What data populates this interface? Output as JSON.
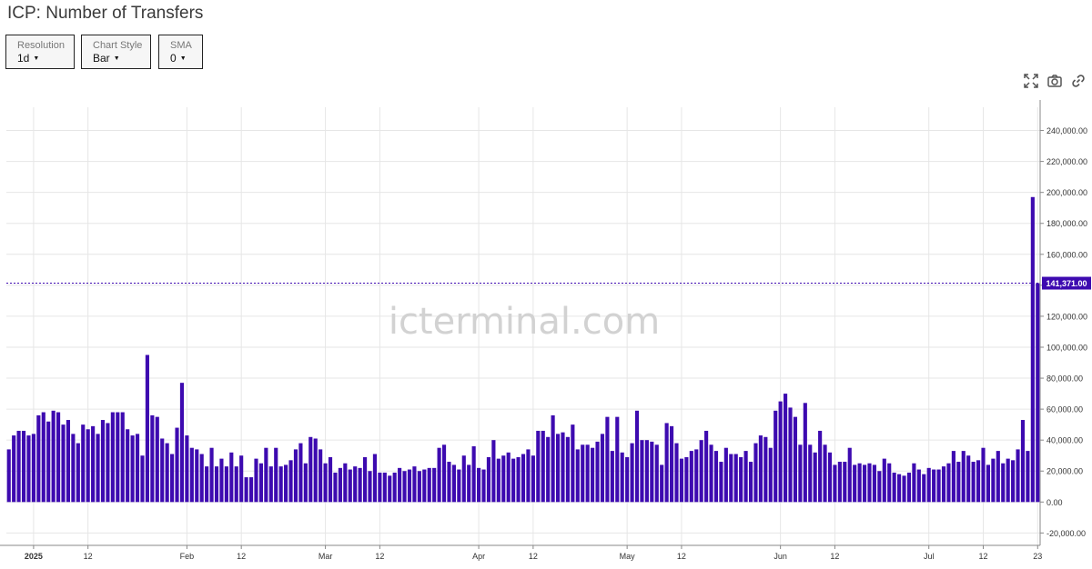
{
  "header": {
    "title": "ICP: Number of Transfers"
  },
  "controls": [
    {
      "label": "Resolution",
      "value": "1d"
    },
    {
      "label": "Chart Style",
      "value": "Bar"
    },
    {
      "label": "SMA",
      "value": "0"
    }
  ],
  "toolbar": {
    "icons": [
      "expand-icon",
      "camera-icon",
      "link-icon"
    ]
  },
  "watermark": "icterminal.com",
  "colors": {
    "bar": "#3d0ab0",
    "price_line": "#3d0ab0",
    "price_tag_bg": "#3d0ab0",
    "grid": "#e6e6e6",
    "text": "#333333"
  },
  "chart_data": {
    "type": "bar",
    "title": "ICP: Number of Transfers",
    "x_start": "2024-12-27",
    "x_tick_labels": [
      {
        "date": "2025-01-01",
        "label": "2025",
        "bold": true
      },
      {
        "date": "2025-01-12",
        "label": "12",
        "bold": false
      },
      {
        "date": "2025-02-01",
        "label": "Feb",
        "bold": false
      },
      {
        "date": "2025-02-12",
        "label": "12",
        "bold": false
      },
      {
        "date": "2025-03-01",
        "label": "Mar",
        "bold": false
      },
      {
        "date": "2025-03-12",
        "label": "12",
        "bold": false
      },
      {
        "date": "2025-04-01",
        "label": "Apr",
        "bold": false
      },
      {
        "date": "2025-04-12",
        "label": "12",
        "bold": false
      },
      {
        "date": "2025-05-01",
        "label": "May",
        "bold": false
      },
      {
        "date": "2025-05-12",
        "label": "12",
        "bold": false
      },
      {
        "date": "2025-06-01",
        "label": "Jun",
        "bold": false
      },
      {
        "date": "2025-06-12",
        "label": "12",
        "bold": false
      },
      {
        "date": "2025-07-01",
        "label": "Jul",
        "bold": false
      },
      {
        "date": "2025-07-12",
        "label": "12",
        "bold": false
      },
      {
        "date": "2025-07-23",
        "label": "23",
        "bold": false
      }
    ],
    "y_tick_labels": [
      "-20,000.00",
      "0.00",
      "20,000.00",
      "40,000.00",
      "60,000.00",
      "80,000.00",
      "100,000.00",
      "120,000.00",
      "140,000.00",
      "160,000.00",
      "180,000.00",
      "200,000.00",
      "220,000.00",
      "240,000.00"
    ],
    "ylim": [
      -28000,
      255000
    ],
    "grid": true,
    "last_value": 141371,
    "last_value_label": "141,371.00",
    "values": [
      34000,
      43000,
      46000,
      46000,
      43000,
      44000,
      56000,
      58000,
      52000,
      59000,
      58000,
      50000,
      53000,
      44000,
      38000,
      50000,
      47000,
      49000,
      44000,
      53000,
      51000,
      58000,
      58000,
      58000,
      47000,
      43000,
      44000,
      30000,
      95000,
      56000,
      55000,
      41000,
      38000,
      31000,
      48000,
      77000,
      43000,
      35000,
      34000,
      31000,
      23000,
      35000,
      23000,
      28000,
      23000,
      32000,
      23000,
      30000,
      16000,
      16000,
      28000,
      25000,
      35000,
      23000,
      35000,
      23000,
      24000,
      27000,
      34000,
      38000,
      25000,
      42000,
      41000,
      34000,
      25000,
      29000,
      19000,
      22000,
      25000,
      21000,
      23000,
      22000,
      29000,
      20000,
      31000,
      19000,
      19000,
      17000,
      19000,
      22000,
      20000,
      21000,
      23000,
      20000,
      21000,
      22000,
      22000,
      35000,
      37000,
      26000,
      24000,
      21000,
      30000,
      24000,
      36000,
      22000,
      21000,
      29000,
      40000,
      28000,
      30000,
      32000,
      28000,
      29000,
      31000,
      34000,
      30000,
      46000,
      46000,
      42000,
      56000,
      44000,
      45000,
      42000,
      50000,
      34000,
      37000,
      37000,
      35000,
      39000,
      44000,
      55000,
      33000,
      55000,
      32000,
      29000,
      38000,
      59000,
      40000,
      40000,
      39000,
      37000,
      24000,
      51000,
      49000,
      38000,
      28000,
      29000,
      33000,
      34000,
      40000,
      46000,
      37000,
      33000,
      26000,
      35000,
      31000,
      31000,
      29000,
      33000,
      26000,
      38000,
      43000,
      42000,
      35000,
      59000,
      65000,
      70000,
      61000,
      55000,
      37000,
      64000,
      37000,
      32000,
      46000,
      37000,
      32000,
      24000,
      26000,
      26000,
      35000,
      24000,
      25000,
      24000,
      25000,
      24000,
      20000,
      28000,
      25000,
      19000,
      18000,
      17000,
      19000,
      25000,
      21000,
      18000,
      22000,
      21000,
      21000,
      23000,
      25000,
      33000,
      26000,
      33000,
      30000,
      26000,
      27000,
      35000,
      24000,
      28000,
      33000,
      25000,
      28000,
      27000,
      34000,
      53000,
      33000,
      197000,
      141371
    ]
  }
}
